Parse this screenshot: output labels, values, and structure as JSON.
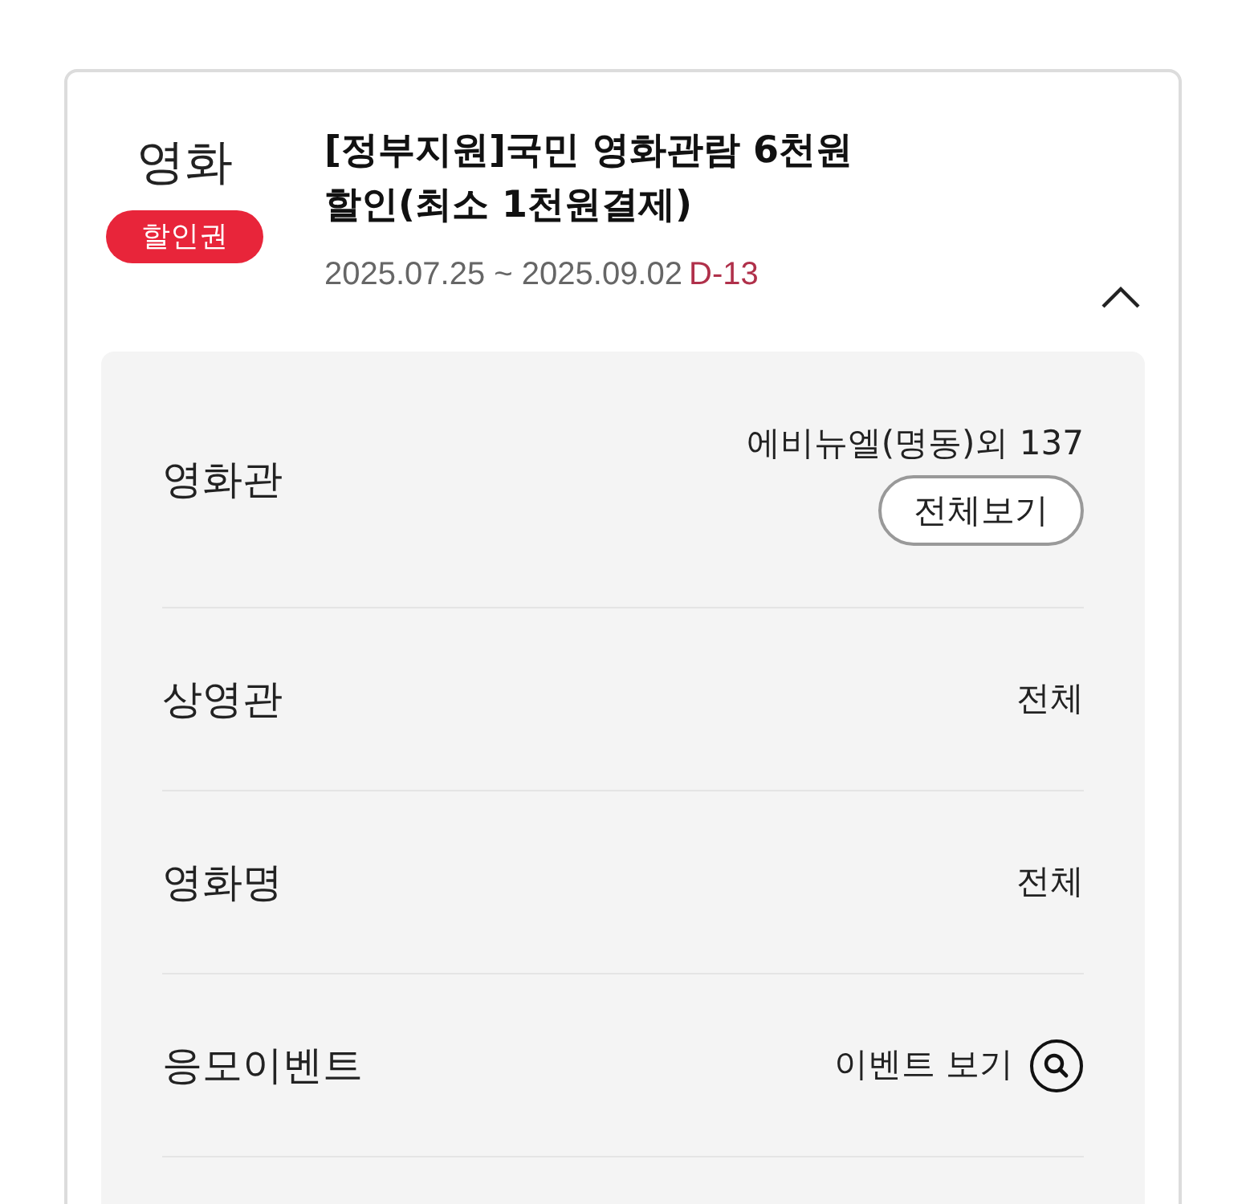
{
  "category": "영화",
  "badge": "할인권",
  "title": "[정부지원]국민 영화관람 6천원\n할인(최소 1천원결제)",
  "period": "2025.07.25 ~ 2025.09.02",
  "dday": "D-13",
  "expanded": true,
  "details": [
    {
      "kind": "button",
      "label": "영화관",
      "value": "에비뉴엘(명동)외 137",
      "button": "전체보기"
    },
    {
      "kind": "text",
      "label": "상영관",
      "value": "전체"
    },
    {
      "kind": "text",
      "label": "영화명",
      "value": "전체"
    },
    {
      "kind": "search",
      "label": "응모이벤트",
      "value": "이벤트 보기"
    }
  ]
}
